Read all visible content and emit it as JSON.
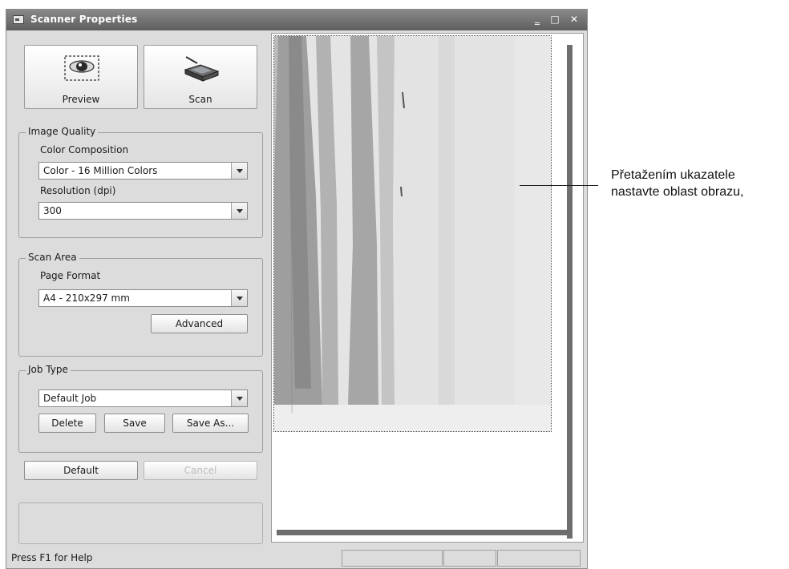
{
  "window": {
    "title": "Scanner Properties",
    "controls": {
      "minimize": "‗",
      "maximize": "□",
      "close": "✕"
    }
  },
  "toolbar": {
    "preview_label": "Preview",
    "scan_label": "Scan"
  },
  "image_quality": {
    "legend": "Image Quality",
    "color_label": "Color Composition",
    "color_value": "Color - 16 Million Colors",
    "resolution_label": "Resolution (dpi)",
    "resolution_value": "300"
  },
  "scan_area": {
    "legend": "Scan Area",
    "page_format_label": "Page Format",
    "page_format_value": "A4 - 210x297 mm",
    "advanced_label": "Advanced"
  },
  "job_type": {
    "legend": "Job Type",
    "value": "Default Job",
    "delete_label": "Delete",
    "save_label": "Save",
    "save_as_label": "Save As..."
  },
  "actions": {
    "default_label": "Default",
    "cancel_label": "Cancel"
  },
  "status": {
    "help_text": "Press F1 for Help"
  },
  "annotation": {
    "line1": "Přetažením ukazatele",
    "line2": "nastavte oblast obrazu,"
  }
}
